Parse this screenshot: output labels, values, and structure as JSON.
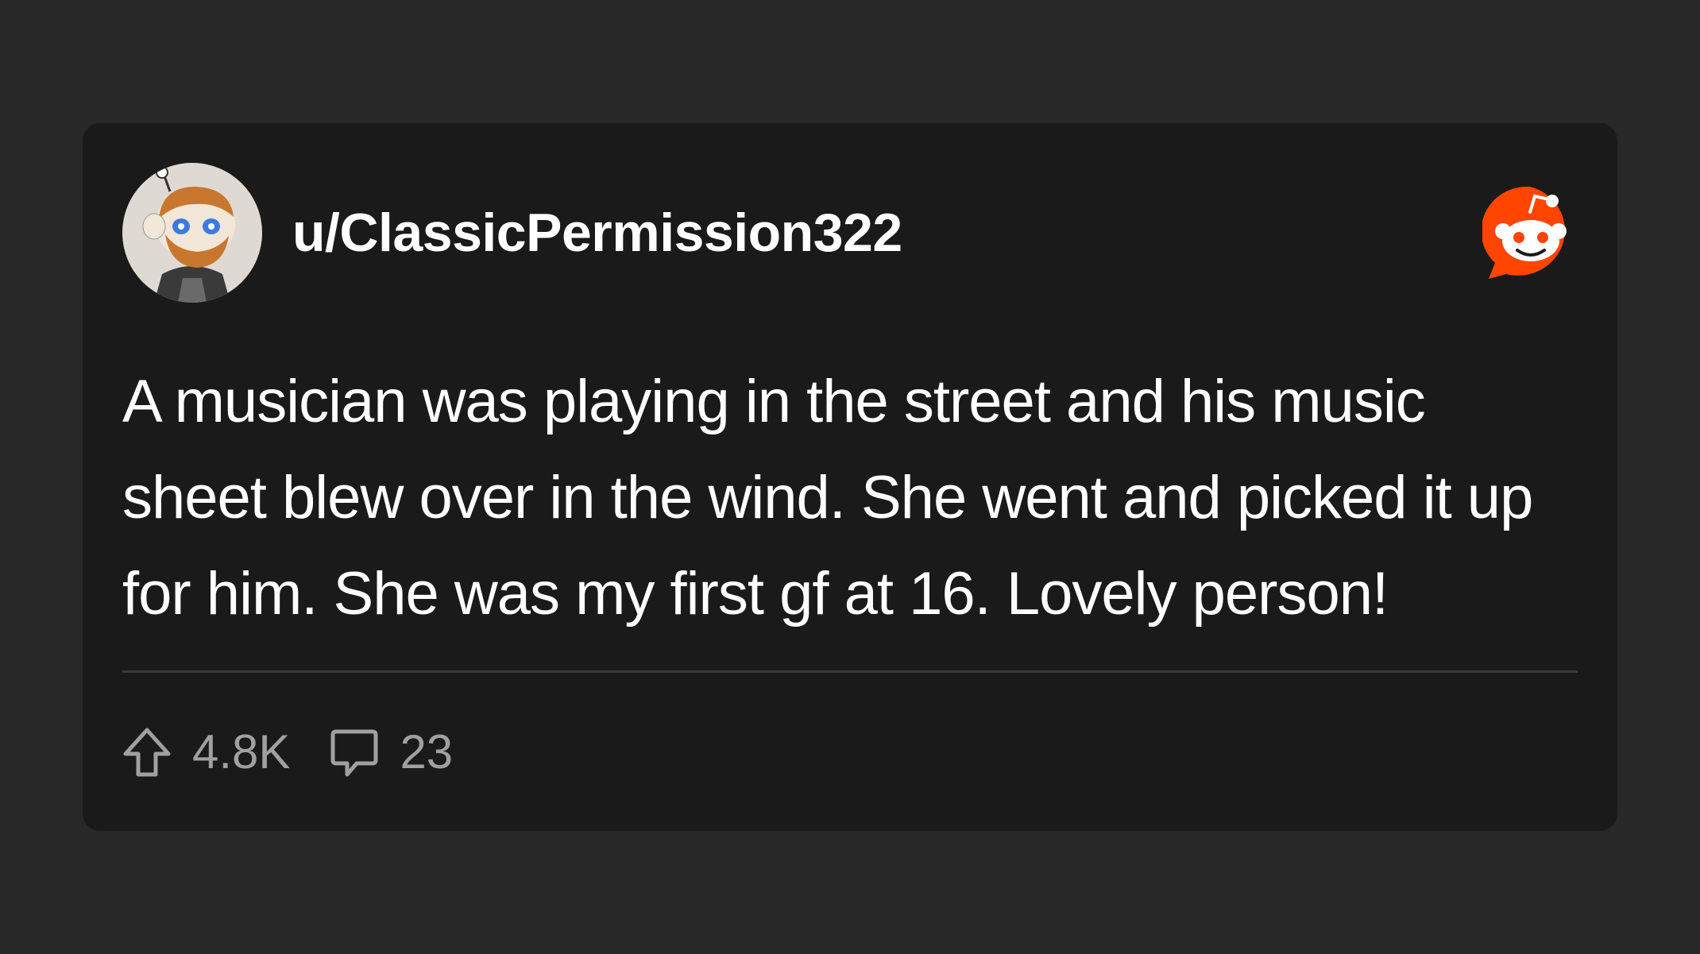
{
  "post": {
    "username": "u/ClassicPermission322",
    "body": "A musician was playing in the street and his music sheet blew over in the wind. She went and picked it up for him. She was my first gf at 16. Lovely person!"
  },
  "stats": {
    "upvotes": "4.8K",
    "comments": "23"
  },
  "icons": {
    "avatar": "user-avatar-icon",
    "logo": "reddit-logo-icon",
    "upvote": "upvote-arrow-icon",
    "comment": "comment-bubble-icon"
  },
  "colors": {
    "background": "#282828",
    "card": "#1a1a1b",
    "accent": "#ff4500",
    "text": "#ffffff",
    "muted": "#a0a0a0"
  }
}
